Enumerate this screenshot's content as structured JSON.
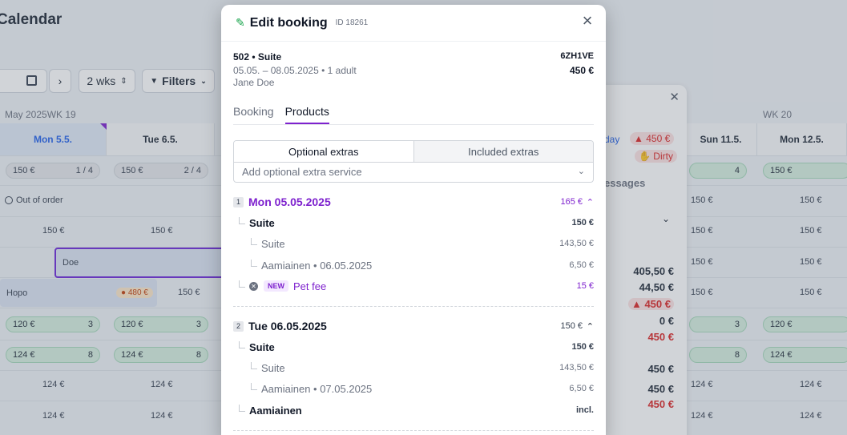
{
  "calendar": {
    "title": "Calendar",
    "view": "2 wks",
    "filters_label": "Filters",
    "month_label": "May 2025",
    "week19": "WK 19",
    "week20": "WK 20",
    "days": [
      "Mon 5.5.",
      "Tue 6.5.",
      "Sun 11.5.",
      "Mon 12.5."
    ],
    "out_of_order": "Out of order",
    "pill_150": "150 €",
    "occ_1": "1 / 4",
    "occ_2": "2 / 4",
    "occ_4": "4",
    "price_150": "150 €",
    "price_120": "120 €",
    "price_124": "124 €",
    "count_3": "3",
    "count_8": "8",
    "booking_doe": "Doe",
    "booking_hopo": "Hopo",
    "price_480": "480 €",
    "colors": {
      "today": "#2563eb",
      "booking_border": "#6d28d9",
      "alert": "#dc2626"
    }
  },
  "side_panel": {
    "day_label": "day",
    "alert_amount": "450 €",
    "dirty": "Dirty",
    "messages": "essages",
    "amounts": [
      "405,50 €",
      "44,50 €",
      "450 €",
      "0 €",
      "450 €",
      "450 €",
      "450 €",
      "450 €"
    ]
  },
  "modal": {
    "title": "Edit booking",
    "booking_id": "ID 18261",
    "room": "502 • Suite",
    "dates": "05.05. – 08.05.2025 • 1 adult",
    "guest": "Jane Doe",
    "code": "6ZH1VE",
    "total": "450 €",
    "tabs": [
      "Booking",
      "Products"
    ],
    "active_tab": "Products",
    "extras_tabs": [
      "Optional extras",
      "Included extras"
    ],
    "add_placeholder": "Add optional extra service",
    "days": [
      {
        "num": "1",
        "name": "Mon 05.05.2025",
        "amount": "165 €",
        "accent": "#7e22ce",
        "room_label": "Suite",
        "room_amount": "150 €",
        "sub": [
          {
            "label": "Suite",
            "amount": "143,50 €"
          },
          {
            "label": "Aamiainen • 06.05.2025",
            "amount": "6,50 €"
          }
        ],
        "extra": {
          "badge": "NEW",
          "label": "Pet fee",
          "amount": "15 €"
        }
      },
      {
        "num": "2",
        "name": "Tue 06.05.2025",
        "amount": "150 €",
        "room_label": "Suite",
        "room_amount": "150 €",
        "sub": [
          {
            "label": "Suite",
            "amount": "143,50 €"
          },
          {
            "label": "Aamiainen • 07.05.2025",
            "amount": "6,50 €"
          }
        ],
        "included": {
          "label": "Aamiainen",
          "amount": "incl."
        }
      }
    ]
  }
}
